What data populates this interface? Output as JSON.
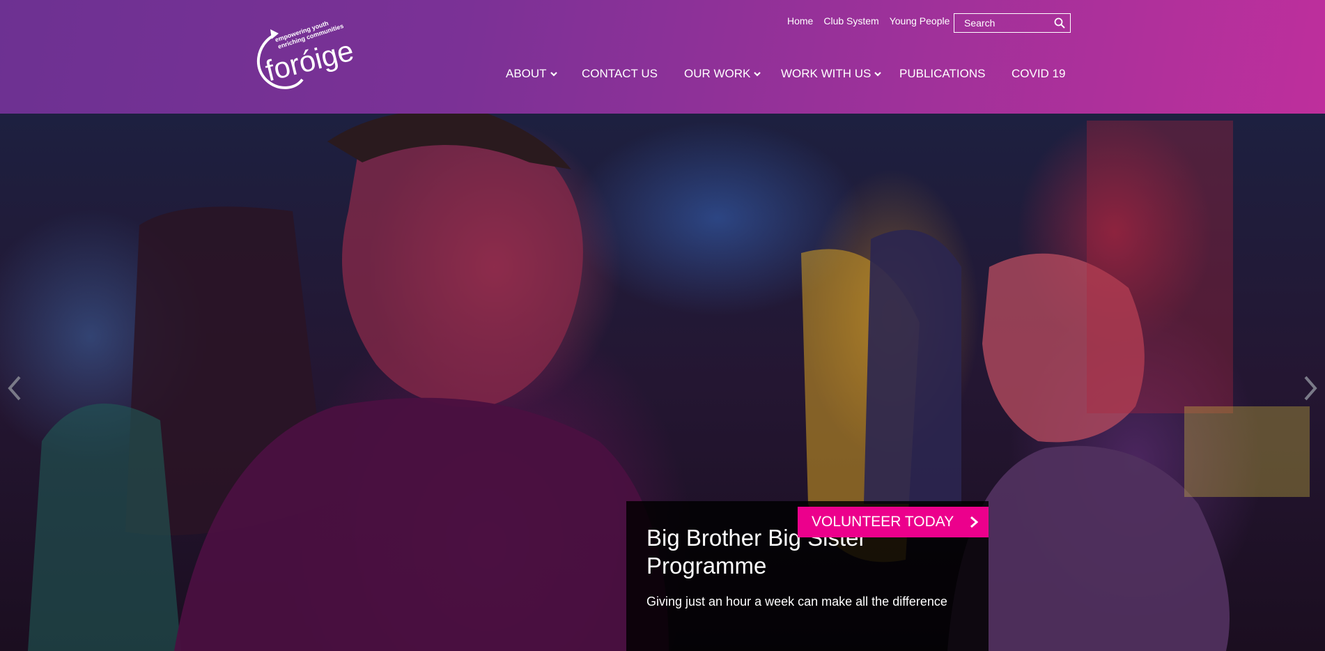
{
  "logo": {
    "name": "foróige",
    "tagline_line1": "empowering youth",
    "tagline_line2": "enriching communities"
  },
  "utility_nav": [
    "Home",
    "Club System",
    "Young People"
  ],
  "search": {
    "placeholder": "Search"
  },
  "main_nav": [
    {
      "label": "ABOUT",
      "dropdown": true
    },
    {
      "label": "CONTACT US",
      "dropdown": false
    },
    {
      "label": "OUR WORK",
      "dropdown": true
    },
    {
      "label": "WORK WITH US",
      "dropdown": true
    },
    {
      "label": "PUBLICATIONS",
      "dropdown": false
    },
    {
      "label": "COVID 19",
      "dropdown": false
    }
  ],
  "hero": {
    "title": "Big Brother Big Sister Programme",
    "subtitle": "Giving just an hour a week can make all the difference",
    "cta_label": "VOLUNTEER TODAY"
  },
  "colors": {
    "header_start": "#6d3192",
    "header_end": "#be2f9c",
    "cta": "#ec008c"
  }
}
